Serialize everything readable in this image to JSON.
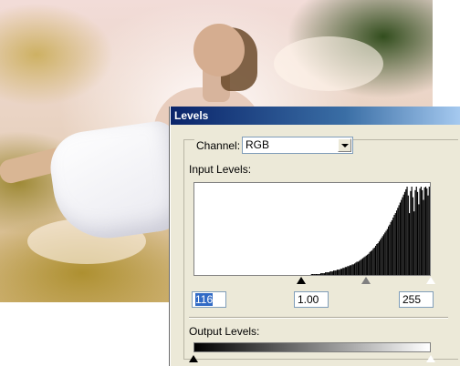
{
  "dialog": {
    "title": "Levels",
    "channel_label": "Channel:",
    "channel_value": "RGB",
    "input_levels_label": "Input Levels:",
    "input_black": "116",
    "input_gamma": "1.00",
    "input_white": "255",
    "output_levels_label": "Output Levels:",
    "histogram": [
      0,
      0,
      0,
      0,
      0,
      0,
      0,
      0,
      0,
      0,
      0,
      0,
      0,
      0,
      0,
      0,
      0,
      0,
      0,
      0,
      0,
      0,
      0,
      0,
      0,
      0,
      0,
      0,
      0,
      0,
      0,
      0,
      0,
      0,
      0,
      0,
      0,
      0,
      0,
      0,
      0,
      0,
      0,
      0,
      0,
      0,
      0,
      0,
      0,
      0,
      0,
      0,
      0,
      0,
      0,
      0,
      0,
      0,
      0,
      0,
      0,
      0,
      0,
      0,
      0,
      0,
      0,
      0,
      0,
      0,
      0,
      0,
      0,
      0,
      0,
      0,
      0,
      0,
      0,
      0,
      0,
      0,
      0,
      0,
      0,
      0,
      0,
      0,
      0,
      0,
      0,
      0,
      0,
      0,
      0,
      0,
      0,
      0,
      0,
      0,
      1,
      1,
      1,
      1,
      1,
      1,
      1,
      1,
      2,
      2,
      2,
      2,
      3,
      3,
      3,
      3,
      4,
      4,
      4,
      5,
      5,
      5,
      6,
      6,
      6,
      7,
      7,
      8,
      8,
      9,
      9,
      10,
      10,
      11,
      11,
      12,
      12,
      13,
      14,
      15,
      15,
      16,
      17,
      18,
      19,
      20,
      21,
      22,
      23,
      24,
      26,
      27,
      28,
      30,
      31,
      33,
      35,
      36,
      38,
      40,
      42,
      44,
      46,
      48,
      50,
      52,
      55,
      57,
      60,
      62,
      65,
      68,
      70,
      73,
      76,
      79,
      82,
      85,
      88,
      91,
      94,
      97,
      100,
      90,
      70,
      95,
      100,
      88,
      72,
      96,
      100,
      94,
      80,
      98,
      100,
      96,
      85,
      99,
      100,
      98,
      90,
      100
    ],
    "slider_black": 0.455,
    "slider_gamma": 0.725,
    "slider_white": 1.0,
    "output_black": 0,
    "output_white": 1.0
  },
  "colors": {
    "titlebar": "#0a246a",
    "selection": "#316ac5"
  }
}
